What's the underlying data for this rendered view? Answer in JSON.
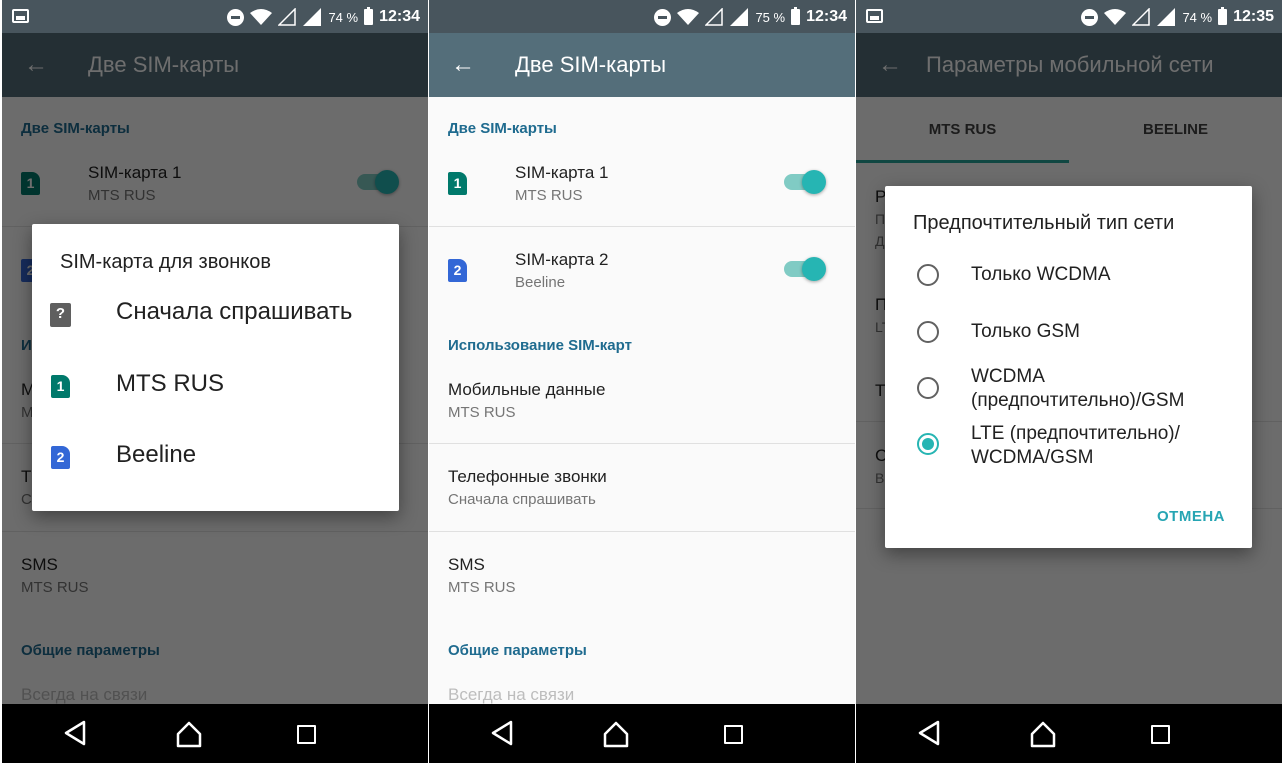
{
  "status_bars": [
    {
      "battery": "74 %",
      "time": "12:34"
    },
    {
      "battery": "75 %",
      "time": "12:34"
    },
    {
      "battery": "74 %",
      "time": "12:35"
    }
  ],
  "phone1": {
    "title": "Две SIM-карты",
    "section_dual": "Две SIM-карты",
    "sim1_title": "SIM-карта 1",
    "sim1_sub": "MTS RUS",
    "sms_title": "SMS",
    "sms_sub": "MTS RUS",
    "section_general": "Общие параметры",
    "always_on": "Всегда на связи",
    "peek_i": "И",
    "peek_m": "М",
    "peek_m2": "М",
    "peek_t": "Т",
    "peek_c": "С",
    "peek_2": "2",
    "dialog": {
      "title": "SIM-карта для звонков",
      "items": [
        {
          "label": "Сначала спрашивать",
          "icon": "?"
        },
        {
          "label": "MTS RUS",
          "icon": "1"
        },
        {
          "label": "Beeline",
          "icon": "2"
        }
      ]
    }
  },
  "phone2": {
    "title": "Две SIM-карты",
    "section_dual": "Две SIM-карты",
    "sim1_title": "SIM-карта 1",
    "sim1_sub": "MTS RUS",
    "sim1_icon": "1",
    "sim2_title": "SIM-карта 2",
    "sim2_sub": "Beeline",
    "sim2_icon": "2",
    "section_usage": "Использование SIM-карт",
    "data_title": "Мобильные данные",
    "data_sub": "MTS RUS",
    "calls_title": "Телефонные звонки",
    "calls_sub": "Сначала спрашивать",
    "sms_title": "SMS",
    "sms_sub": "MTS RUS",
    "section_general": "Общие параметры",
    "always_on": "Всегда на связи"
  },
  "phone3": {
    "title": "Параметры мобильной сети",
    "tabs": [
      "MTS RUS",
      "BEELINE"
    ],
    "peek": [
      "Р",
      "П",
      "Д",
      "П",
      "LT",
      "Т",
      "С",
      "В"
    ],
    "dialog": {
      "title": "Предпочтительный тип сети",
      "options": [
        {
          "label": "Только WCDMA",
          "selected": false
        },
        {
          "label": "Только GSM",
          "selected": false
        },
        {
          "label": "WCDMA (предпочтительно)/GSM",
          "selected": false
        },
        {
          "label": "LTE (предпочтительно)/ WCDMA/GSM",
          "selected": true
        }
      ],
      "cancel": "ОТМЕНА"
    }
  },
  "colors": {
    "appbar": "#546e7a",
    "statusbar": "#48555d",
    "accent": "#26b5b3",
    "section": "#1f6b8f",
    "sim1": "#00796b",
    "sim2": "#3367d6"
  }
}
